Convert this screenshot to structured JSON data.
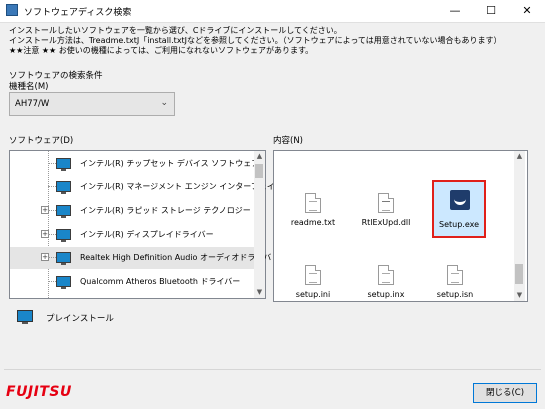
{
  "window": {
    "title": "ソフトウェアディスク検索",
    "minimize_glyph": "—",
    "maximize_glyph": "☐",
    "close_glyph": "✕"
  },
  "info_lines": [
    "インストールしたいソフトウェアを一覧から選び、Cドライブにインストールしてください。",
    "インストール方法は、Treadme.txtJ「install.txtJなどを参照してください。（ソフトウェアによっては用意されていない場合もあります）",
    "★★注意 ★★ お使いの機種によっては、ご利用になれないソフトウェアがあります。"
  ],
  "search_conditions": {
    "heading": "ソフトウェアの検索条件",
    "model_label": "機種名(M)",
    "model_value": "AH77/W"
  },
  "software_panel": {
    "label": "ソフトウェア(D)",
    "items": [
      {
        "label": "インテル(R) チップセット デバイス ソフトウェア",
        "expander": ""
      },
      {
        "label": "インテル(R) マネージメント エンジン インターフェイ",
        "expander": ""
      },
      {
        "label": "インテル(R) ラピッド ストレージ テクノロジー",
        "expander": "+"
      },
      {
        "label": "インテル(R) ディスプレイドライバー",
        "expander": "+"
      },
      {
        "label": "Realtek High Definition Audio オーディオドライバ",
        "expander": "+"
      },
      {
        "label": "Qualcomm Atheros Bluetooth ドライバー",
        "expander": ""
      }
    ],
    "selected_index": 4
  },
  "contents_panel": {
    "label": "内容(N)",
    "files": [
      {
        "name": "readme.txt"
      },
      {
        "name": "RtlExUpd.dll"
      },
      {
        "name": "Setup.exe"
      },
      {
        "name": "setup.ini"
      },
      {
        "name": "setup.inx"
      },
      {
        "name": "setup.isn"
      }
    ]
  },
  "preinstall_label": "プレインストール",
  "brand": "FUJITSU",
  "close_button_label": "閉じる(C)",
  "colors": {
    "brand_red": "#e60012",
    "highlight_border": "#e0201a",
    "selection_blue": "#cce8ff"
  }
}
